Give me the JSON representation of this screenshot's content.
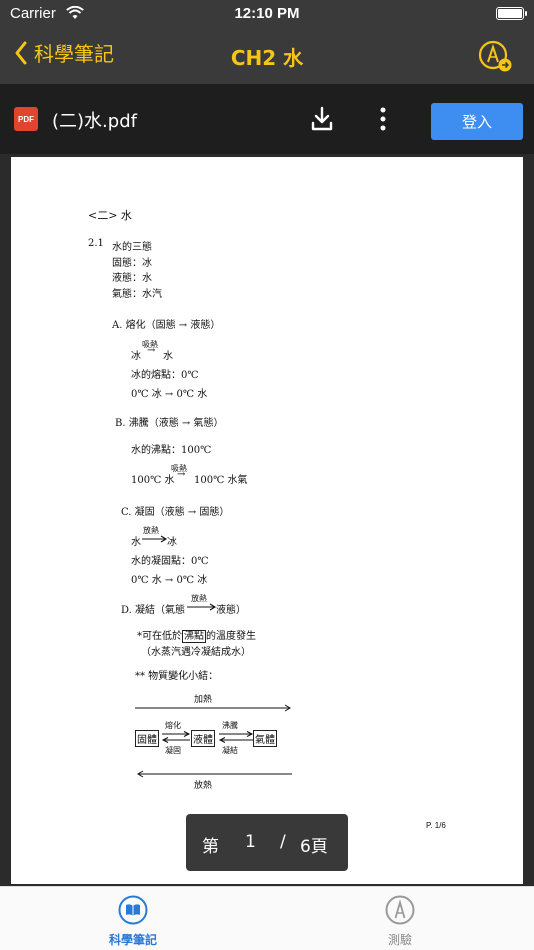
{
  "status_bar": {
    "carrier": "Carrier",
    "time": "12:10 PM"
  },
  "nav": {
    "back_label": "科學筆記",
    "title": "CH2 水"
  },
  "toolbar": {
    "filename": "(二)水.pdf",
    "login_label": "登入",
    "pdf_badge": "PDF"
  },
  "document": {
    "chapter": "<二> 水",
    "section_number": "2.1",
    "section_title": "水的三態",
    "states": [
      "固態：冰",
      "液態：水",
      "氣態：水汽"
    ],
    "a_title": "A.  熔化（固態 → 液態）",
    "a_eq1_left": "冰",
    "a_eq1_arrow": "→",
    "a_eq1_label": "吸熱",
    "a_eq1_right": "水",
    "a_melting_point": "冰的熔點：0℃",
    "a_eq2": "0℃  冰 → 0℃  水",
    "b_title": "B.  沸騰（液態 → 氣態）",
    "b_boiling_point": "水的沸點：100℃",
    "b_eq_left": "100℃  水",
    "b_eq_arrow": "→",
    "b_eq_label": "吸熱",
    "b_eq_right": "100℃  水氣",
    "c_title": "C.  凝固（液態 → 固態）",
    "c_eq1_left": "水",
    "c_eq1_label": "放熱",
    "c_eq1_right": "冰",
    "c_freezing_point": "水的凝固點：0℃",
    "c_eq2": "0℃  水 → 0℃  冰",
    "d_title_prefix": "D.  凝結（氣態",
    "d_label": "放熱",
    "d_title_suffix": "液態）",
    "note_prefix": "*可在低於",
    "note_boxed": "沸點",
    "note_suffix": "的溫度發生",
    "note_line2": "（水蒸汽遇冷凝結成水）",
    "summary_title": "**  物質變化小結：",
    "diagram": {
      "heating": "加熱",
      "cooling": "放熱",
      "solid": "固體",
      "liquid": "液體",
      "gas": "氣體",
      "melt": "熔化",
      "freeze": "凝固",
      "boil": "沸騰",
      "condense": "凝結"
    },
    "page_number": "P. 1/6"
  },
  "page_indicator": {
    "prefix": "第",
    "current": "1",
    "separator": "/",
    "total": "6頁"
  },
  "tabs": [
    {
      "label": "科學筆記",
      "icon": "book-icon",
      "active": true
    },
    {
      "label": "測驗",
      "icon": "pencil-circle-icon",
      "active": false
    }
  ],
  "colors": {
    "accent": "#f5c518",
    "nav_bg": "#3a3a3a",
    "toolbar_bg": "#1e1e1e",
    "login_blue": "#3d8ef0",
    "tab_active": "#2a7ad5",
    "pdf_red": "#e2452e"
  }
}
